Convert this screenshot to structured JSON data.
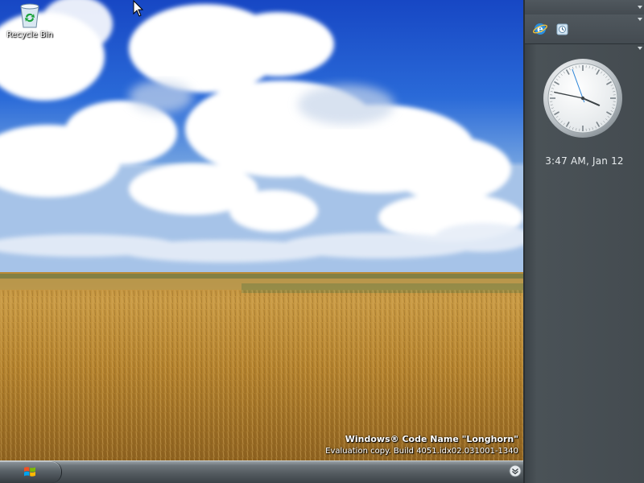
{
  "desktop": {
    "icons": [
      {
        "label": "Recycle Bin",
        "icon": "recycle-bin-icon"
      }
    ],
    "watermark": {
      "title": "Windows® Code Name \"Longhorn\"",
      "build": "Evaluation copy. Build 4051.idx02.031001-1340"
    }
  },
  "sidebar": {
    "tiles": [
      {
        "icon": "internet-explorer-icon"
      },
      {
        "icon": "clock-tile-icon"
      }
    ],
    "clock": {
      "time_text": "3:47 AM, Jan 12",
      "hour": 3,
      "minute": 47
    }
  },
  "taskbar": {
    "start_icon": "windows-logo-icon",
    "tray_icon": "chevron-down-icon"
  }
}
